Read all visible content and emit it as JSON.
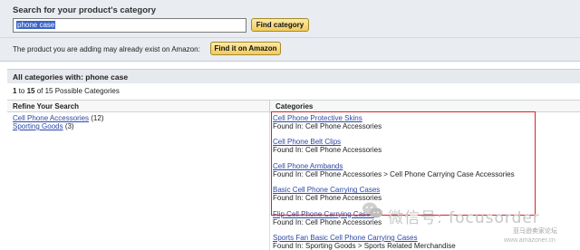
{
  "search": {
    "title": "Search for your product's category",
    "input_value": "phone case",
    "find_category_label": "Find category",
    "exist_text": "The product you are adding may already exist on Amazon:",
    "find_amazon_label": "Find it on Amazon"
  },
  "results": {
    "header": "All categories with:  phone case",
    "range_start": "1",
    "range_mid": " to ",
    "range_end": "15",
    "range_rest": " of 15 Possible Categories"
  },
  "columns": {
    "refine": "Refine Your Search",
    "categories": "Categories"
  },
  "refine": [
    {
      "label": "Cell Phone Accessories",
      "count": " (12)"
    },
    {
      "label": "Sporting Goods",
      "count": " (3)"
    }
  ],
  "categories": [
    {
      "link": "Cell Phone Protective Skins",
      "found": "Found In: Cell Phone Accessories"
    },
    {
      "link": "Cell Phone Belt Clips",
      "found": "Found In: Cell Phone Accessories"
    },
    {
      "link": "Cell Phone Armbands",
      "found": "Found In: Cell Phone Accessories > Cell Phone Carrying Case Accessories"
    },
    {
      "link": "Basic Cell Phone Carrying Cases",
      "found": "Found In: Cell Phone Accessories"
    },
    {
      "link": "Flip Cell Phone Carrying Cases",
      "found": "Found In: Cell Phone Accessories"
    },
    {
      "link": "Sports Fan Basic Cell Phone Carrying Cases",
      "found": "Found In: Sporting Goods > Sports Related Merchandise"
    }
  ],
  "watermark": {
    "text": "微信号: focusorder",
    "sub": "亚马逊卖家论坛",
    "site": "www.amazoner.cn"
  },
  "colors": {
    "link": "#2b48a8",
    "highlight_box": "#d8222a",
    "button": "#f1cb5d"
  }
}
